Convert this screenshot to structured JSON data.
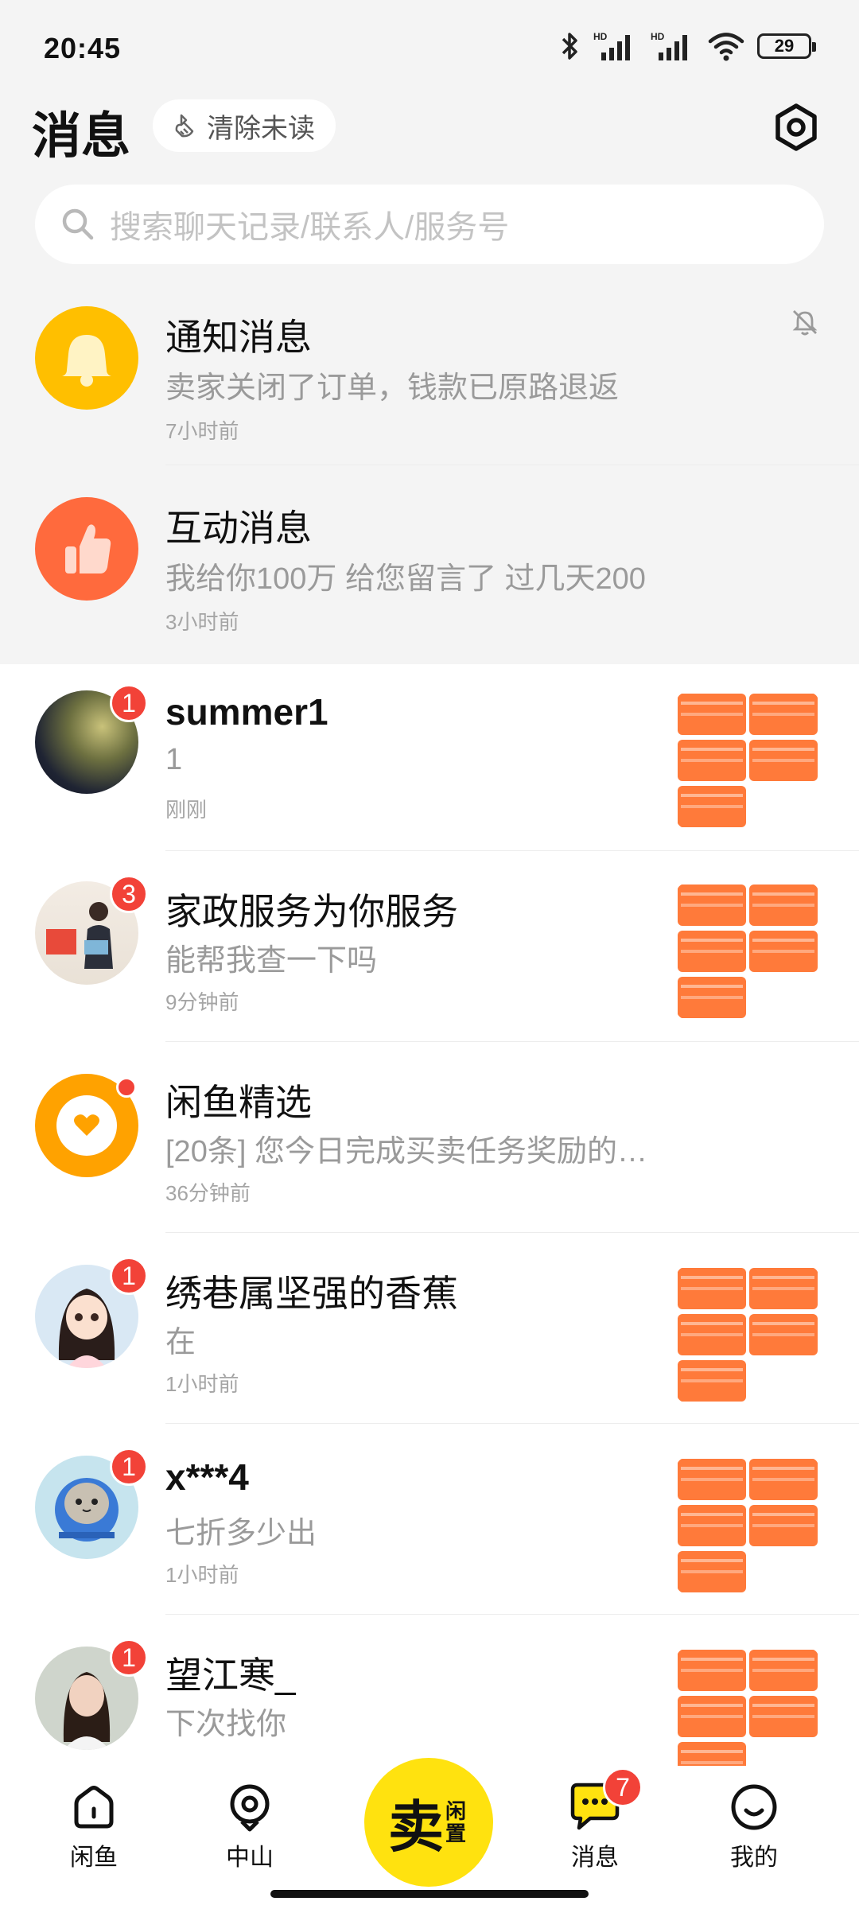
{
  "status_bar": {
    "time": "20:45",
    "battery": "29",
    "hd1": "HD",
    "hd2": "HD"
  },
  "header": {
    "title": "消息",
    "clear_unread": "清除未读"
  },
  "search": {
    "placeholder": "搜索聊天记录/联系人/服务号"
  },
  "system_rows": [
    {
      "title": "通知消息",
      "subtitle": "卖家关闭了订单，钱款已原路退返",
      "time": "7小时前",
      "icon": "bell-icon",
      "color": "#ffbf00"
    },
    {
      "title": "互动消息",
      "subtitle": "我给你100万 给您留言了 过几天200",
      "time": "3小时前",
      "icon": "thumbs-up-icon",
      "color": "#ff6a3d"
    }
  ],
  "chats": [
    {
      "name": "summer1",
      "message": "1",
      "time": "刚刚",
      "badge": "1"
    },
    {
      "name": "家政服务为你服务",
      "message": "能帮我查一下吗",
      "time": "9分钟前",
      "badge": "3"
    },
    {
      "name": "闲鱼精选",
      "message": "[20条] 您今日完成买卖任务奖励的…",
      "time": "36分钟前",
      "badge": ""
    },
    {
      "name": "绣巷属坚强的香蕉",
      "message": "在",
      "time": "1小时前",
      "badge": "1"
    },
    {
      "name": "x***4",
      "message": "七折多少出",
      "time": "1小时前",
      "badge": "1"
    },
    {
      "name": "望江寒_",
      "message": "下次找你",
      "time": "",
      "badge": "1"
    }
  ],
  "bottom_nav": {
    "home": "闲鱼",
    "location": "中山",
    "sell_main": "卖",
    "sell_sub": "闲置",
    "messages": "消息",
    "messages_badge": "7",
    "mine": "我的"
  },
  "colors": {
    "accent_yellow": "#ffe20f",
    "badge_red": "#f24238",
    "coupon_orange": "#ff7a3a"
  }
}
